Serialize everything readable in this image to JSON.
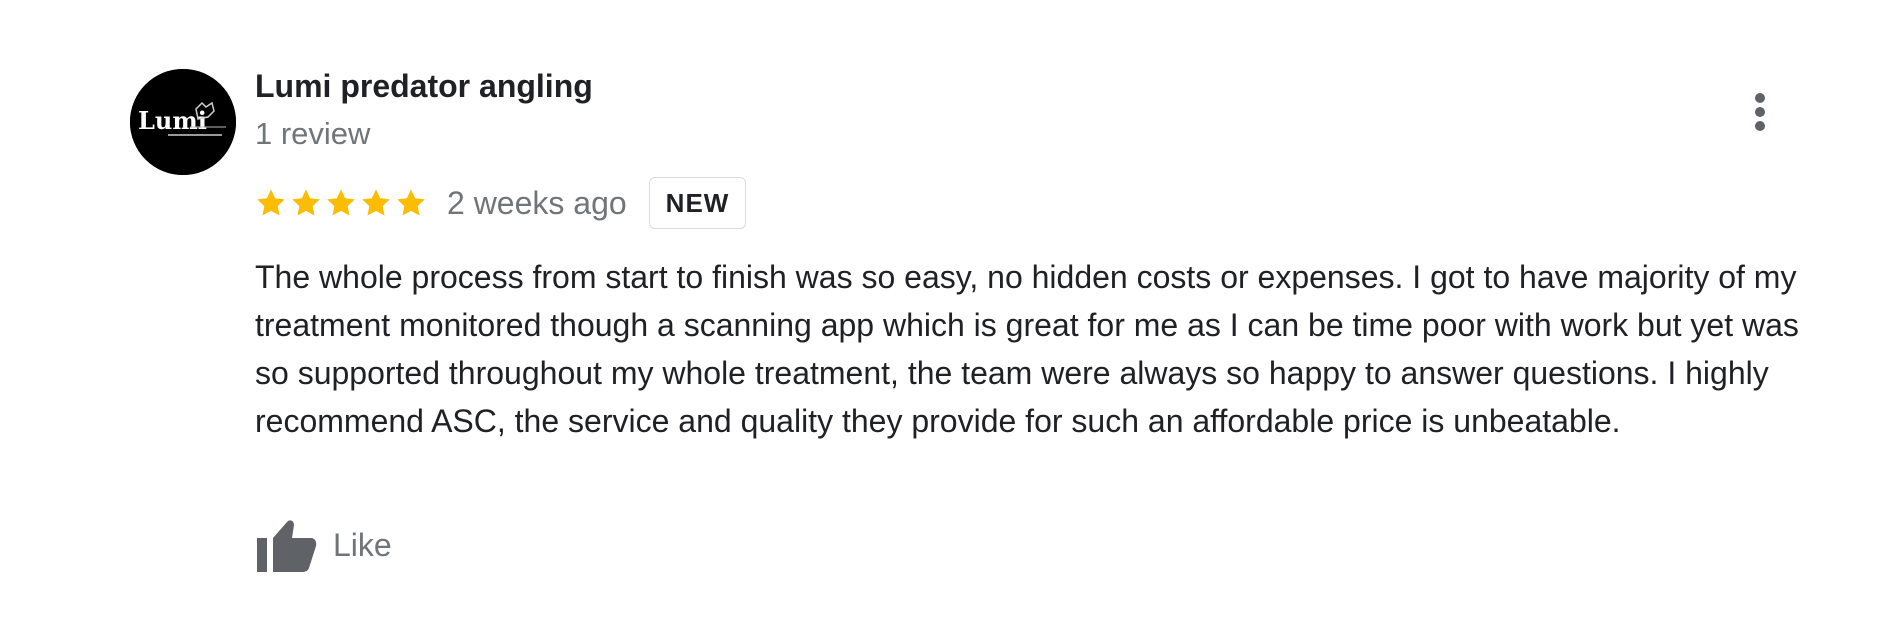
{
  "review": {
    "author": {
      "name": "Lumi predator angling",
      "review_count": "1 review",
      "avatar_logo_text": "Lumi"
    },
    "rating": 5,
    "rating_max": 5,
    "time_ago": "2 weeks ago",
    "badge": "NEW",
    "text": "The whole process from start to finish was so easy, no hidden costs or expenses. I got to have majority of my treatment monitored though a scanning app which is great for me as I can be time poor with work but yet was so supported throughout my whole treatment, the team were always so happy to answer questions. I highly recommend ASC, the service and quality they provide for such an affordable price is unbeatable.",
    "like_label": "Like",
    "icons": {
      "star": "star-icon",
      "more": "more-vert-icon",
      "like": "thumb-up-icon"
    },
    "colors": {
      "star": "#fbbc04",
      "secondary_text": "#70757a",
      "primary_text": "#202124",
      "icon_gray": "#5f6368"
    }
  }
}
